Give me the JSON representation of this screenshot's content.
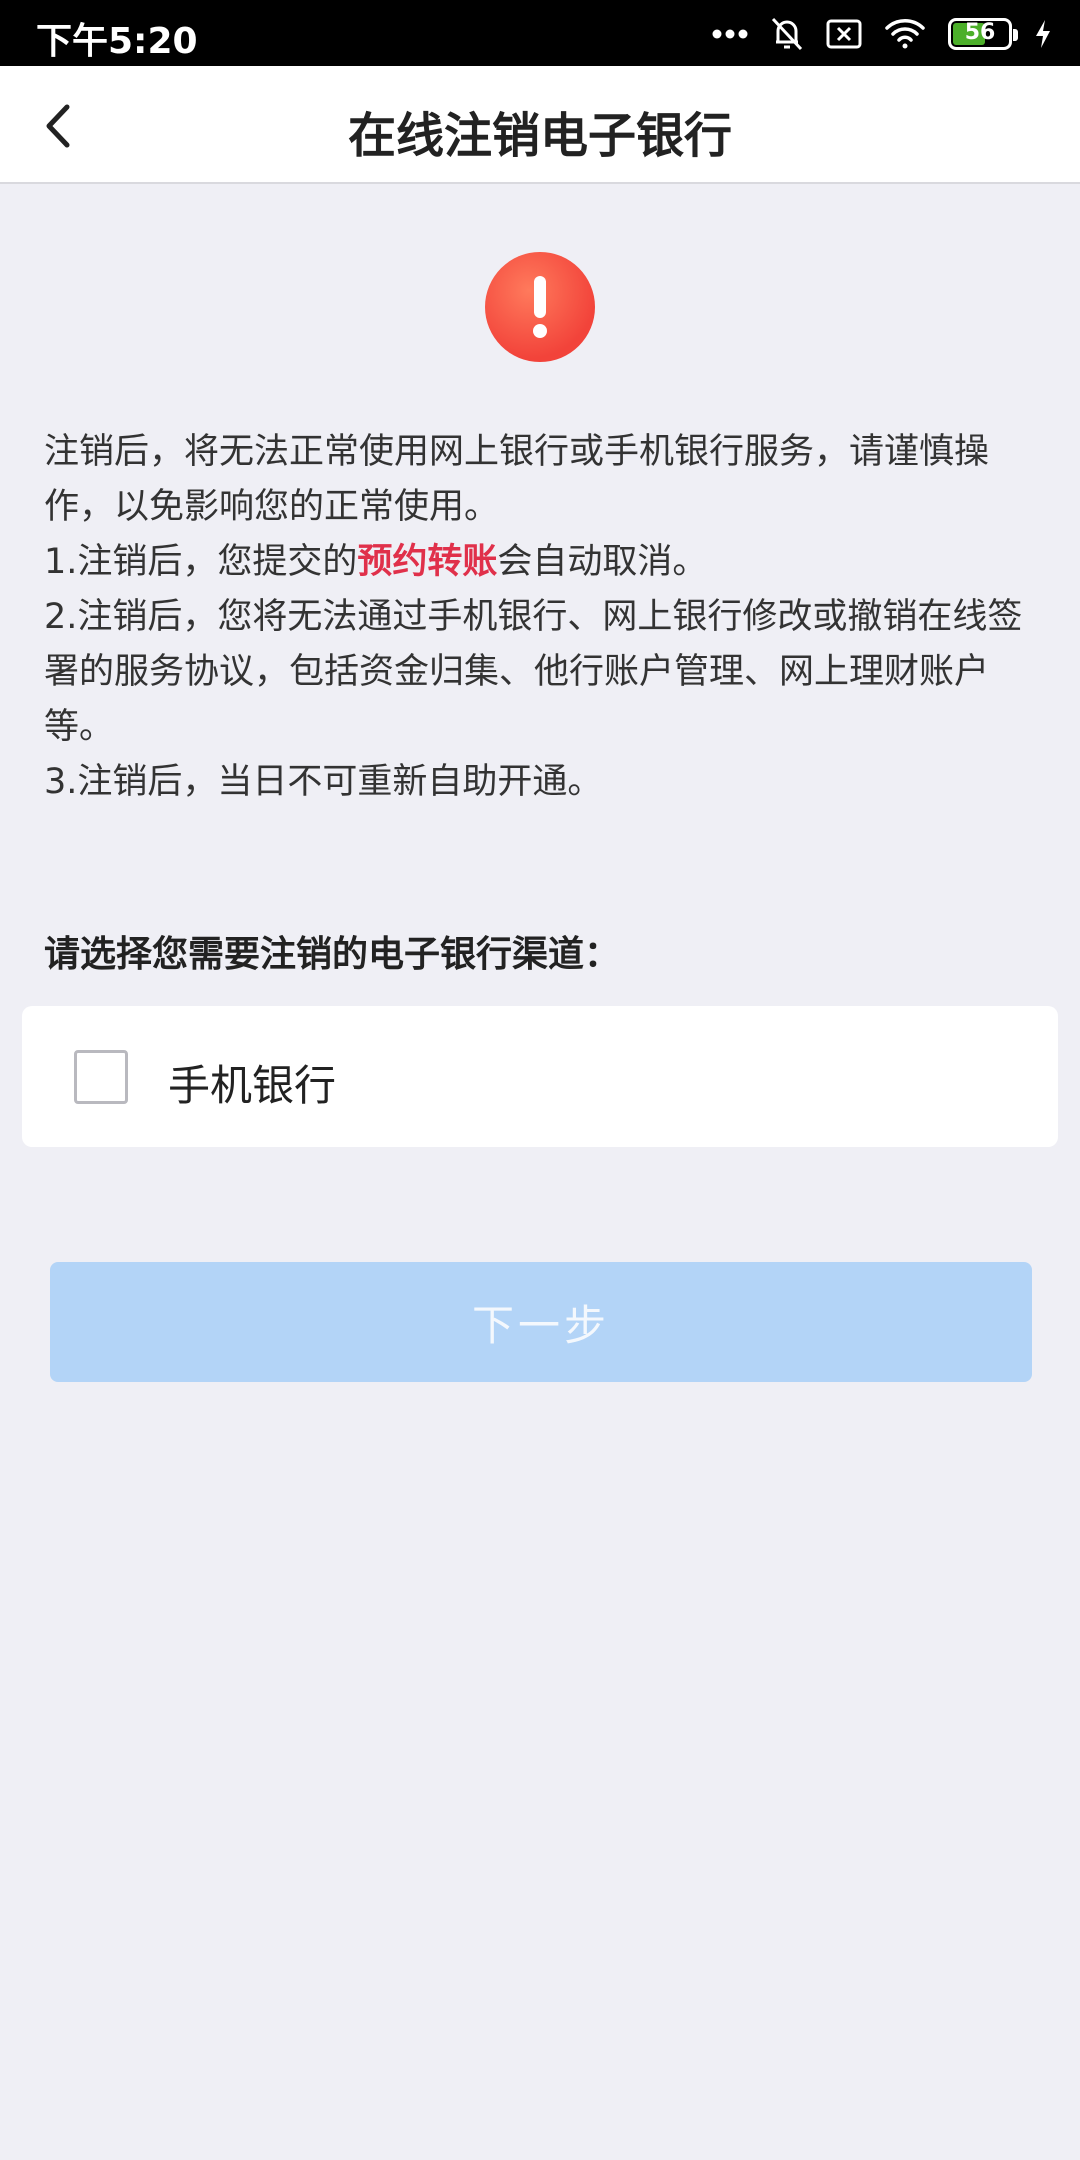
{
  "status_bar": {
    "time": "下午5:20",
    "battery_level": "56",
    "battery_color": "#4caf2a"
  },
  "header": {
    "back_icon": "chevron-left-icon",
    "title": "在线注销电子银行"
  },
  "warning": {
    "icon": "exclamation-icon",
    "icon_color": "#f2433a"
  },
  "notice": {
    "intro": "注销后，将无法正常使用网上银行或手机银行服务，请谨慎操作，以免影响您的正常使用。",
    "item1_prefix": "1.注销后，您提交的",
    "item1_highlight": "预约转账",
    "item1_suffix": "会自动取消。",
    "item2": "2.注销后，您将无法通过手机银行、网上银行修改或撤销在线签署的服务协议，包括资金归集、他行账户管理、网上理财账户等。",
    "item3": "3.注销后，当日不可重新自助开通。",
    "highlight_color": "#e0304a"
  },
  "channel_section": {
    "title": "请选择您需要注销的电子银行渠道：",
    "options": [
      {
        "label": "手机银行",
        "checked": false
      }
    ]
  },
  "actions": {
    "next_label": "下一步",
    "next_enabled": false,
    "button_color": "#b3d4f7"
  }
}
